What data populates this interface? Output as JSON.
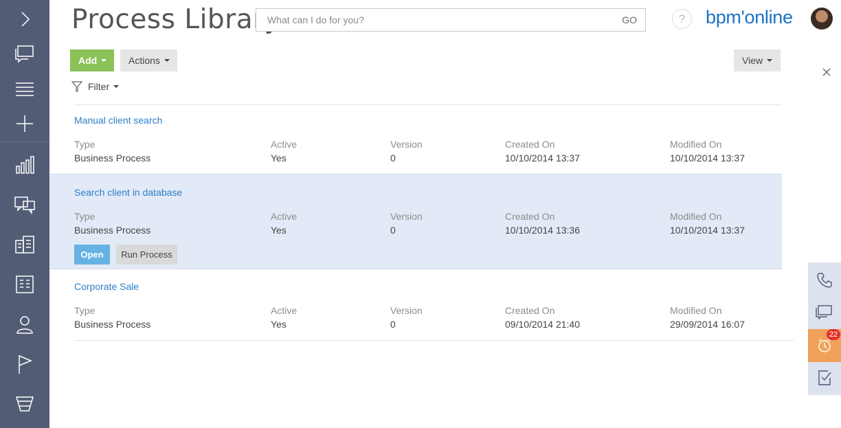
{
  "header": {
    "title": "Process Library",
    "search_placeholder": "What can I do for you?",
    "search_go": "GO",
    "help_label": "?",
    "logo_text": "bpm'online"
  },
  "toolbar": {
    "add_label": "Add",
    "actions_label": "Actions",
    "view_label": "View",
    "filter_label": "Filter"
  },
  "records": [
    {
      "title": "Manual client search",
      "type_label": "Type",
      "type": "Business Process",
      "active_label": "Active",
      "active": "Yes",
      "version_label": "Version",
      "version": "0",
      "created_label": "Created On",
      "created": "10/10/2014 13:37",
      "modified_label": "Modified On",
      "modified": "10/10/2014 13:37"
    },
    {
      "title": "Search client in database",
      "type_label": "Type",
      "type": "Business Process",
      "active_label": "Active",
      "active": "Yes",
      "version_label": "Version",
      "version": "0",
      "created_label": "Created On",
      "created": "10/10/2014 13:36",
      "modified_label": "Modified On",
      "modified": "10/10/2014 13:37",
      "open_label": "Open",
      "run_label": "Run Process"
    },
    {
      "title": "Corporate Sale",
      "type_label": "Type",
      "type": "Business Process",
      "active_label": "Active",
      "active": "Yes",
      "version_label": "Version",
      "version": "0",
      "created_label": "Created On",
      "created": "09/10/2014 21:40",
      "modified_label": "Modified On",
      "modified": "29/09/2014 16:07"
    }
  ],
  "sidebar": {
    "icons": [
      "chevron-right-icon",
      "feed-icon",
      "menu-icon",
      "plus-icon",
      "dashboard-icon",
      "messages-icon",
      "contacts-icon",
      "accounts-icon",
      "user-icon",
      "flag-icon",
      "funnel-icon"
    ]
  },
  "rightbar": {
    "notification_count": "22",
    "icons": [
      "phone-icon",
      "chat-icon",
      "clock-icon",
      "task-icon"
    ]
  },
  "colors": {
    "sidebar": "#525d75",
    "add_button": "#8bc257",
    "link": "#2b7fc7",
    "selected_row": "#e3eaf7",
    "open_button": "#66b3e3",
    "notification": "#f0a25a",
    "badge": "#e4312b",
    "logo": "#1a73c9"
  }
}
